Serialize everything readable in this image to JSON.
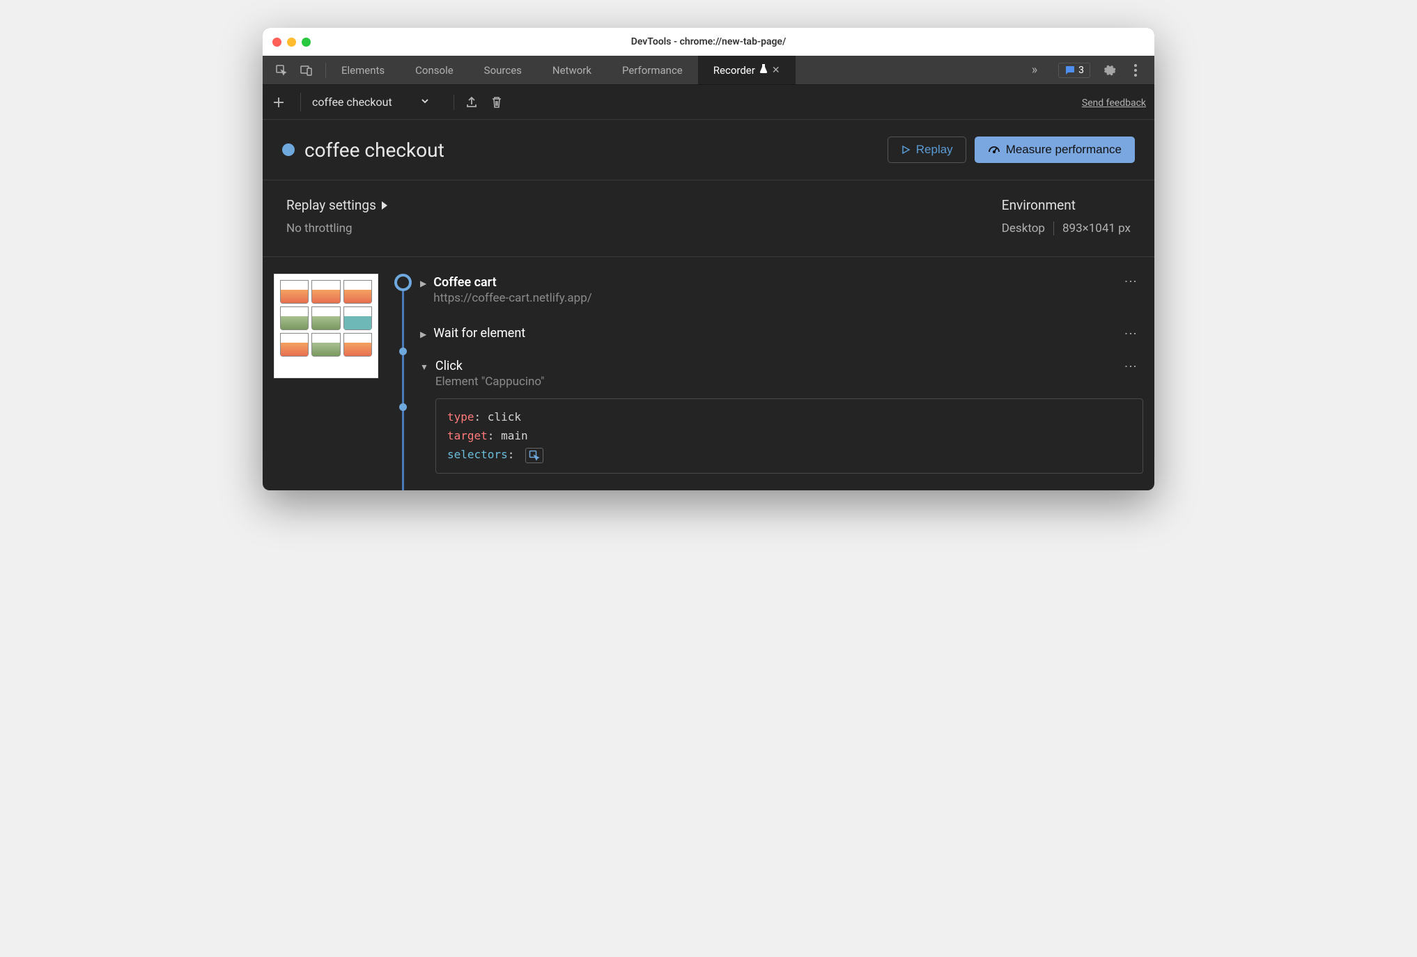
{
  "window": {
    "title": "DevTools - chrome://new-tab-page/"
  },
  "tabs": {
    "items": [
      "Elements",
      "Console",
      "Sources",
      "Network",
      "Performance",
      "Recorder"
    ],
    "active": "Recorder"
  },
  "messages": {
    "count": "3"
  },
  "toolbar": {
    "recording_name": "coffee checkout",
    "feedback": "Send feedback"
  },
  "page": {
    "title": "coffee checkout",
    "replay_btn": "Replay",
    "measure_btn": "Measure performance"
  },
  "settings": {
    "replay_heading": "Replay settings",
    "throttling": "No throttling",
    "env_heading": "Environment",
    "env_device": "Desktop",
    "env_size": "893×1041 px"
  },
  "steps": [
    {
      "title": "Coffee cart",
      "sub": "https://coffee-cart.netlify.app/",
      "expanded": false,
      "big": true
    },
    {
      "title": "Wait for element",
      "sub": "",
      "expanded": false,
      "big": false
    },
    {
      "title": "Click",
      "sub": "Element \"Cappucino\"",
      "expanded": true,
      "big": false
    }
  ],
  "code": {
    "type_key": "type",
    "type_val": "click",
    "target_key": "target",
    "target_val": "main",
    "selectors_key": "selectors"
  }
}
